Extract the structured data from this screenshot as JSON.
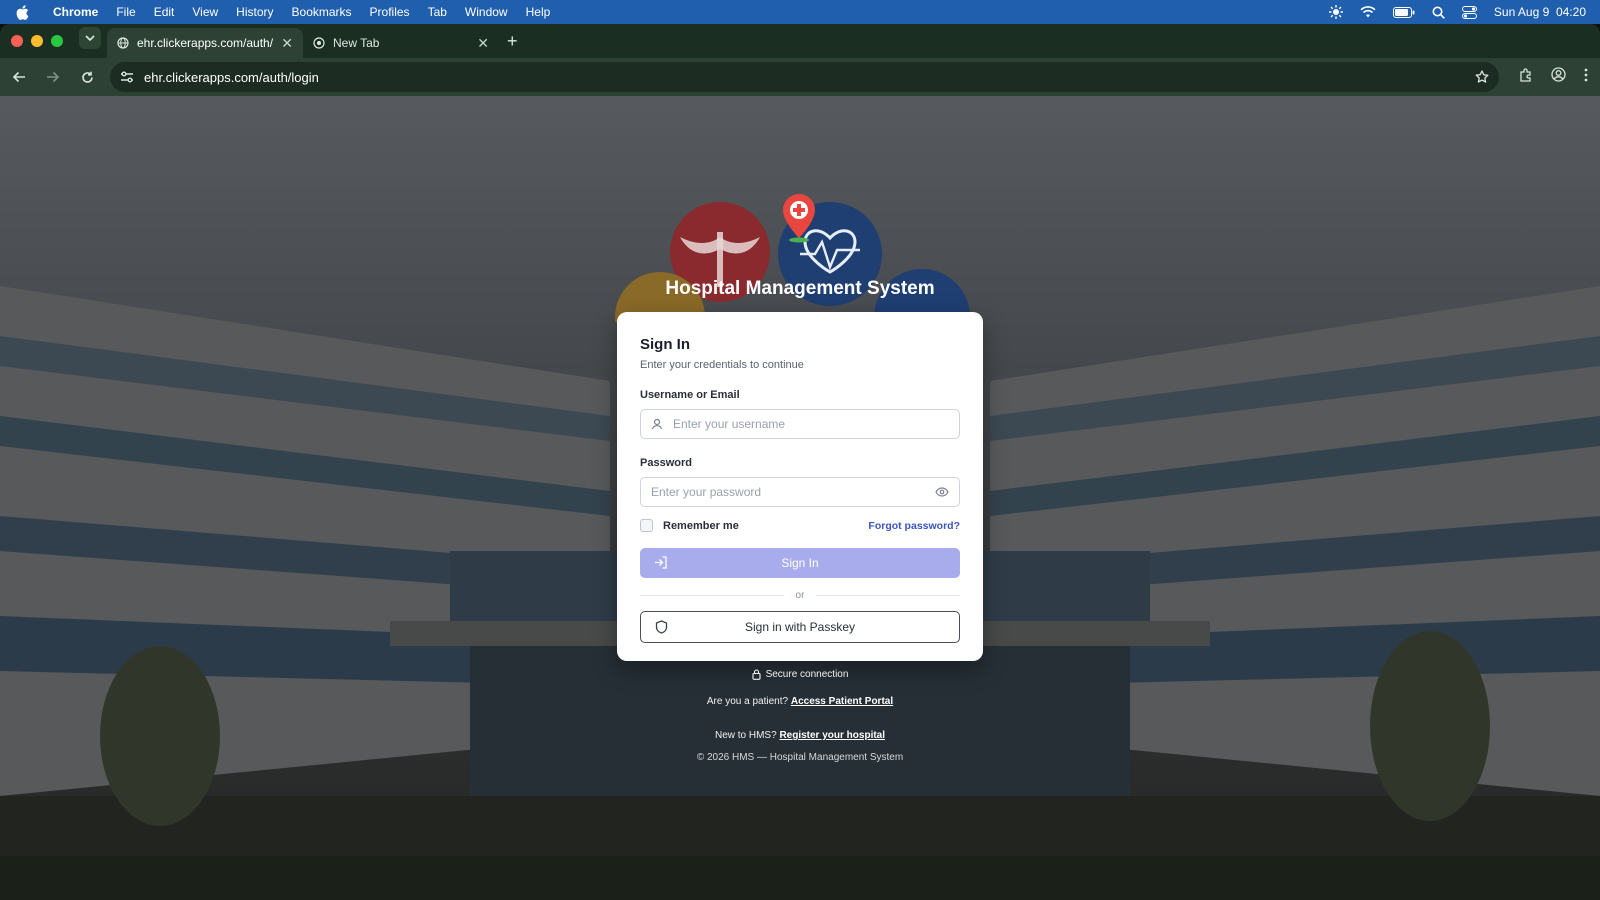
{
  "menubar": {
    "app": "Chrome",
    "items": [
      "File",
      "Edit",
      "View",
      "History",
      "Bookmarks",
      "Profiles",
      "Tab",
      "Window",
      "Help"
    ],
    "clock": "Sun Aug 9  04:20"
  },
  "browser": {
    "tabs": [
      {
        "title": "ehr.clickerapps.com/auth/log",
        "active": true
      },
      {
        "title": "New Tab",
        "active": false
      }
    ],
    "url": "ehr.clickerapps.com/auth/login"
  },
  "page": {
    "app_title": "Hospital Management System",
    "card": {
      "heading": "Sign In",
      "subheading": "Enter your credentials to continue",
      "username_label": "Username or Email",
      "username_placeholder": "Enter your username",
      "password_label": "Password",
      "password_placeholder": "Enter your password",
      "remember_label": "Remember me",
      "forgot_label": "Forgot password?",
      "signin_label": "Sign In",
      "divider_label": "or",
      "passkey_label": "Sign in with Passkey"
    },
    "secure_text": "Secure connection",
    "patient_prompt": "Are you a patient?",
    "patient_link": "Access Patient Portal",
    "register_prompt": "New to HMS?",
    "register_link": "Register your hospital",
    "copyright": "© 2026 HMS — Hospital Management System"
  },
  "colors": {
    "menubar": "#1f5fae",
    "accent": "#3b54c4",
    "signin_button": "#a9acec"
  }
}
